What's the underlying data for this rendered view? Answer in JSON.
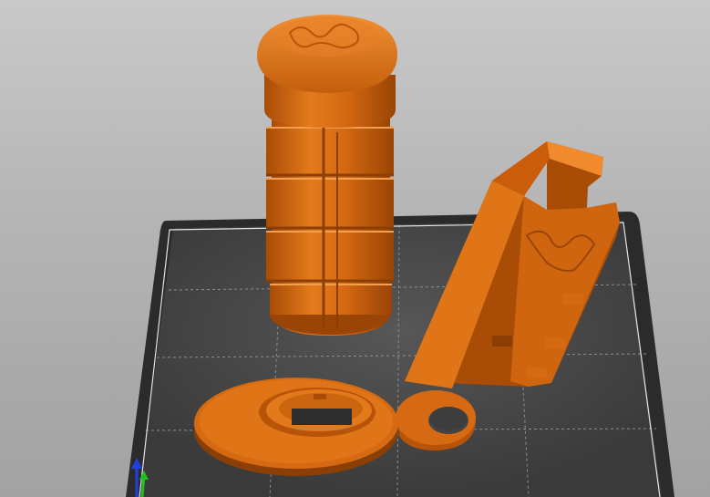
{
  "viewport": {
    "background_top": "#c9c9c9",
    "background_bottom": "#a2a2a2"
  },
  "bed": {
    "surface_color": "#3b3b3b",
    "rim_color": "#2a2a2a",
    "grid_color": "#8c8c8c",
    "edge_color": "#e6e6e6"
  },
  "model_color": {
    "base": "#d66a12",
    "light": "#f08a2c",
    "dark": "#a84c06",
    "shadow": "#7a3603"
  },
  "objects": [
    {
      "name": "cylinder-container"
    },
    {
      "name": "lid-disc-with-keyring"
    },
    {
      "name": "stepped-bracket"
    }
  ],
  "axes": {
    "x_color": "#d92020",
    "y_color": "#20c020",
    "z_color": "#2040e0"
  }
}
